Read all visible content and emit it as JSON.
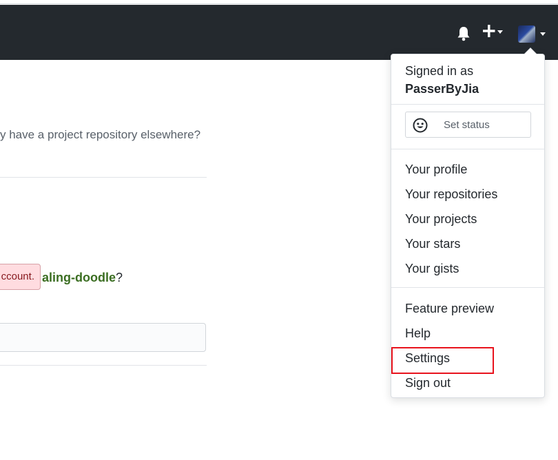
{
  "content": {
    "intro_text": "y have a project repository elsewhere?",
    "flash_text": "ccount.",
    "repo_name": "aling-doodle",
    "repo_suffix": "?"
  },
  "header": {
    "icons": [
      "bell-icon",
      "plus-icon",
      "avatar"
    ]
  },
  "dropdown": {
    "signed_in_label": "Signed in as",
    "username": "PasserByJia",
    "status_button": "Set status",
    "group1": [
      "Your profile",
      "Your repositories",
      "Your projects",
      "Your stars",
      "Your gists"
    ],
    "group2": [
      "Feature preview",
      "Help",
      "Settings",
      "Sign out"
    ]
  },
  "colors": {
    "header_bg": "#24292e",
    "highlight": "#e8121c",
    "flash_bg": "#ffdce0",
    "repo_link": "#3b6e22"
  }
}
